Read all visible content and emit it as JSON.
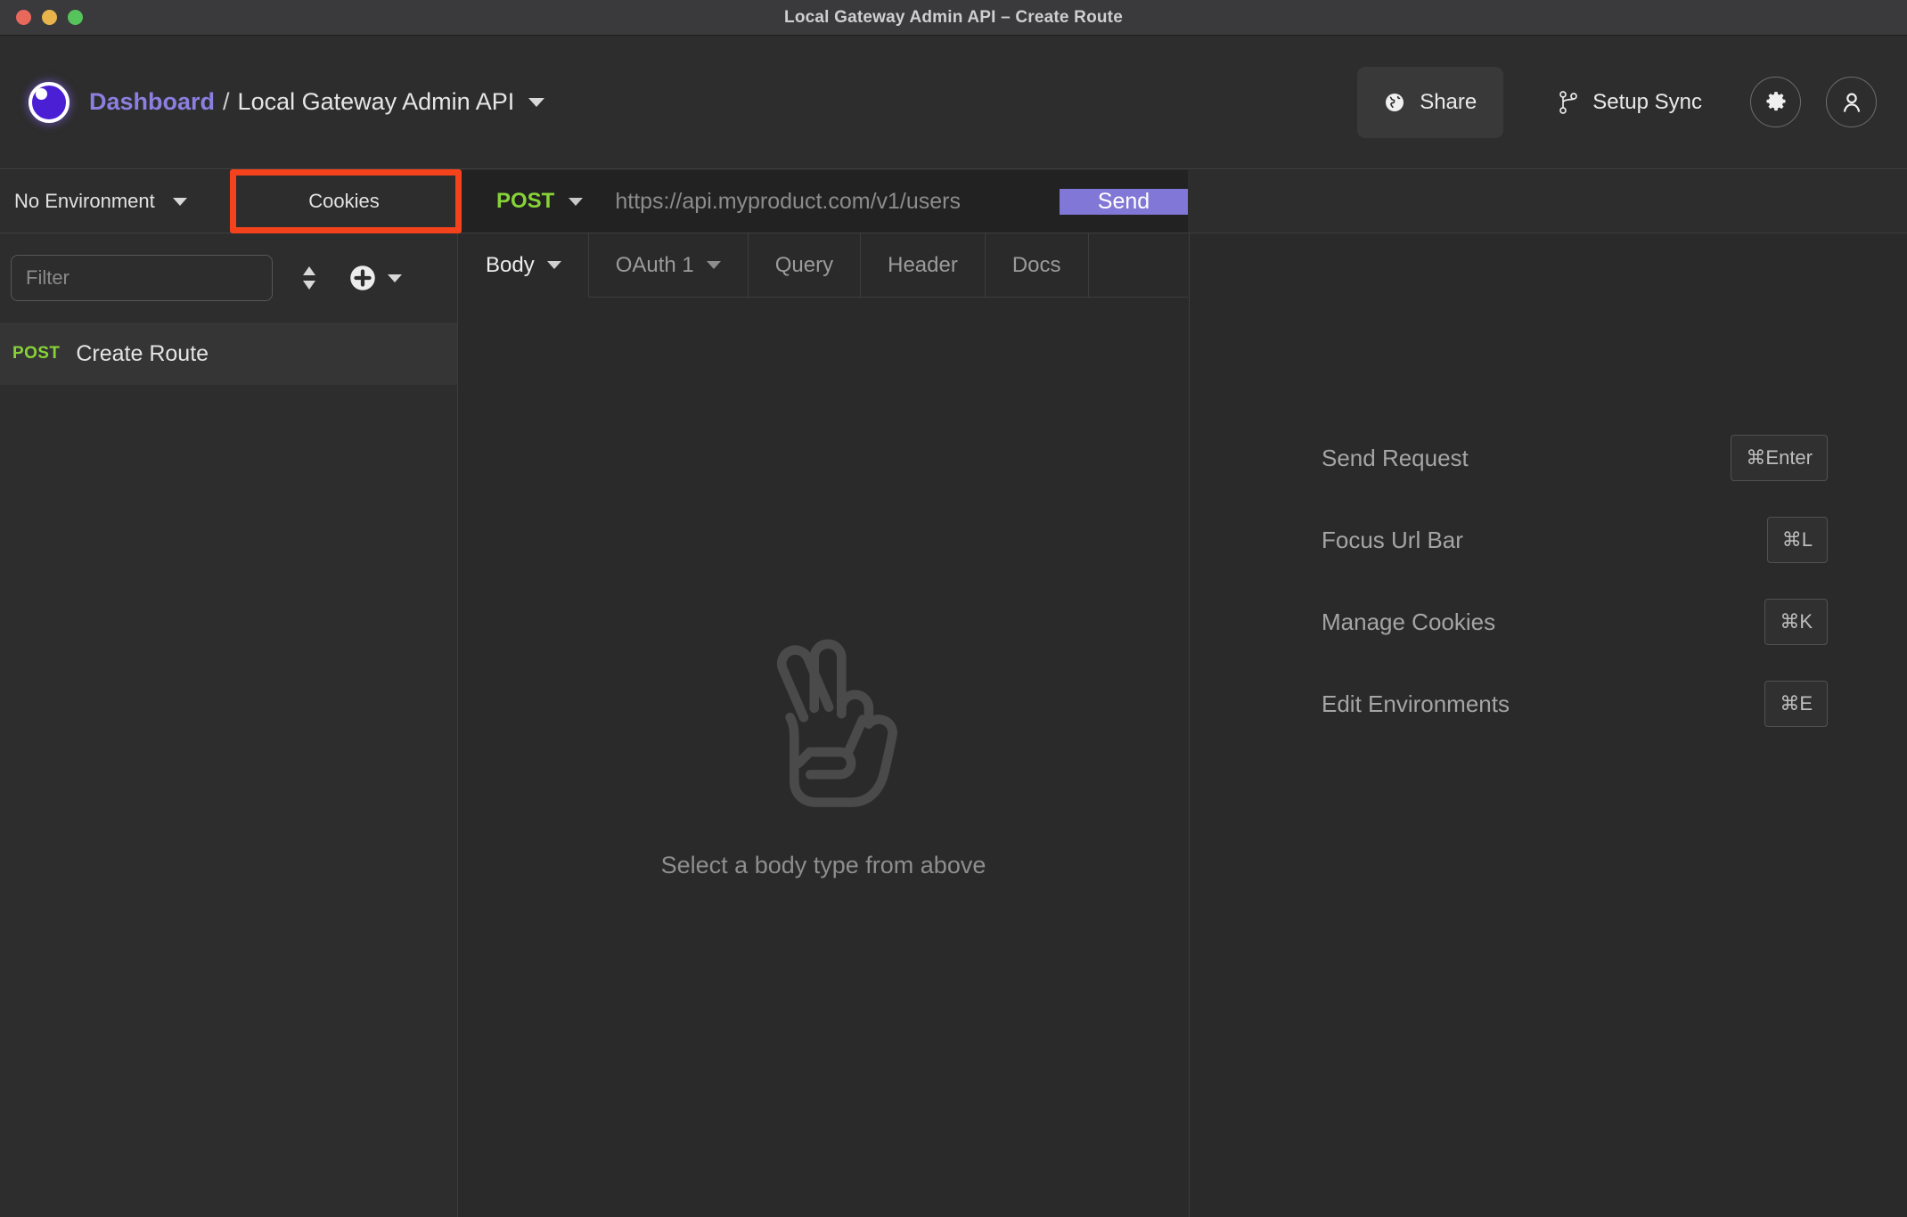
{
  "window": {
    "title": "Local Gateway Admin API – Create Route",
    "traffic_lights": [
      "close",
      "minimize",
      "maximize"
    ]
  },
  "header": {
    "breadcrumb_root": "Dashboard",
    "breadcrumb_separator": "/",
    "breadcrumb_current": "Local Gateway Admin API",
    "share_label": "Share",
    "setup_sync_label": "Setup Sync",
    "settings_icon": "gear-icon",
    "account_icon": "user-icon",
    "logo_icon": "insomnia-logo-icon"
  },
  "toolbar": {
    "environment_label": "No Environment",
    "cookies_label": "Cookies",
    "method": "POST",
    "url_value": "",
    "url_placeholder": "https://api.myproduct.com/v1/users",
    "send_label": "Send"
  },
  "sidebar": {
    "filter_placeholder": "Filter",
    "filter_value": "",
    "sort_icon": "sort-updown-icon",
    "add_icon": "plus-circle-icon",
    "requests": [
      {
        "method": "POST",
        "name": "Create Route",
        "selected": true
      }
    ]
  },
  "center": {
    "tabs": [
      {
        "label": "Body",
        "has_caret": true,
        "active": true
      },
      {
        "label": "OAuth 1",
        "has_caret": true,
        "active": false
      },
      {
        "label": "Query",
        "has_caret": false,
        "active": false
      },
      {
        "label": "Header",
        "has_caret": false,
        "active": false
      },
      {
        "label": "Docs",
        "has_caret": false,
        "active": false
      }
    ],
    "empty_icon": "victory-hand-icon",
    "empty_text": "Select a body type from above"
  },
  "right": {
    "shortcuts": [
      {
        "label": "Send Request",
        "key": "⌘Enter"
      },
      {
        "label": "Focus Url Bar",
        "key": "⌘L"
      },
      {
        "label": "Manage Cookies",
        "key": "⌘K"
      },
      {
        "label": "Edit Environments",
        "key": "⌘E"
      }
    ]
  },
  "annotation": {
    "highlight_target": "cookies-button",
    "highlight_color": "#f4431c"
  },
  "colors": {
    "accent_purple": "#8177d6",
    "method_green": "#87d337",
    "brand_purple": "#8b7fe0",
    "window_bg": "#2a2a2a",
    "panel_bg": "#2d2d2d"
  }
}
